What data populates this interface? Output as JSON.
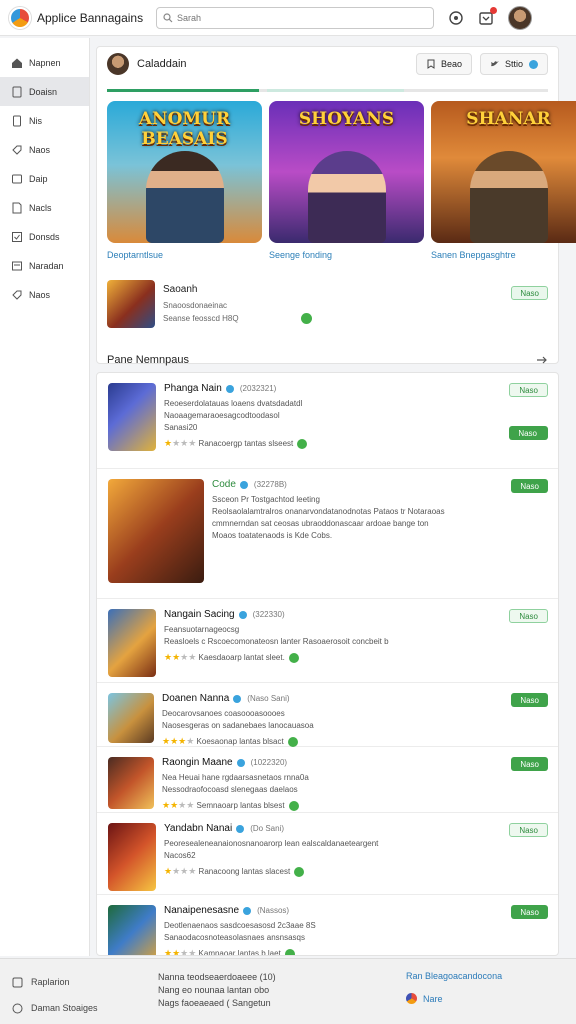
{
  "header": {
    "app_title": "Applice Bannagains",
    "search_placeholder": "Sarah"
  },
  "sidebar": {
    "items": [
      {
        "label": "Napnen",
        "icon": "home-icon"
      },
      {
        "label": "Doaisn",
        "icon": "document-icon"
      },
      {
        "label": "Nis",
        "icon": "page-icon"
      },
      {
        "label": "Naos",
        "icon": "tag-icon"
      },
      {
        "label": "Daip",
        "icon": "folder-icon"
      },
      {
        "label": "Nacls",
        "icon": "note-icon"
      },
      {
        "label": "Donsds",
        "icon": "check-icon"
      },
      {
        "label": "Naradan",
        "icon": "list-icon"
      },
      {
        "label": "Naos",
        "icon": "tag-icon"
      }
    ],
    "active_index": 1
  },
  "feature": {
    "title": "Caladdain",
    "btn1": "Beao",
    "btn2": "Sttio",
    "tiles": [
      {
        "logo": "ANOMUR BEASAIS",
        "caption": "Deoptarntlsue"
      },
      {
        "logo": "SHOYANS",
        "caption": "Seenge fonding"
      },
      {
        "logo": "SHANAR",
        "caption": "Sanen Bnepgasghtre"
      }
    ],
    "mini": {
      "title": "Saoanh",
      "line1": "Snaoosdonaeinac",
      "line2": "Seanse feosscd H8Q",
      "tag": "Naso"
    },
    "section_title": "Pane Nemnpaus"
  },
  "list": [
    {
      "title": "Phanga Nain",
      "count": "(2032321)",
      "lines": [
        "Reoeserdolatauas loaens dvatsdadatdl",
        "Naoaagemaraoesagcodtoodasol",
        "Sanasi20"
      ],
      "rating_text": "Ranacoergp tantas slseest",
      "stars": 1,
      "btn_top": "Naso",
      "btn_bottom": "Naso",
      "accent": "#3aa3dd"
    },
    {
      "title": "Code",
      "count": "(32278B)",
      "lines": [
        "Ssceon Pr Tostgachtod leeting",
        "Reolsaolalamtralros onanarvondatanodnotas Pataos tr Notaraoas",
        "cmmnerndan sat ceosas ubraoddonascaar ardoae bange ton",
        "Moaos toatatenaods is Kde Cobs."
      ],
      "rating_text": "",
      "stars": 0,
      "btn_top": "Naso",
      "btn_bottom": "",
      "accent": "#2e8b3e"
    },
    {
      "title": "Nangain Sacing",
      "count": "(322330)",
      "lines": [
        "Feansuotarnageocsg",
        "Reasloels c Rscoecomonateosn lanter Rasoaerosoit concbeit b"
      ],
      "rating_text": "Kaesdaoarp lantat sleet.",
      "stars": 2,
      "btn_top": "Naso",
      "btn_bottom": "",
      "accent": "#3aa3dd"
    },
    {
      "title": "Doanen Nanna",
      "count": "(Naso Sani)",
      "lines": [
        "Deocarovsanoes coasoooasoooes",
        "Naosesgeras on sadanebaes lanocauasoa"
      ],
      "rating_text": "Koesaonap lantas blsact",
      "stars": 3,
      "btn_top": "Naso",
      "btn_bottom": "",
      "accent": "#3aa3dd"
    },
    {
      "title": "Raongin Maane",
      "count": "(1022320)",
      "lines": [
        "Nea Heuai hane rgdaarsasnetaos rnna0a",
        "Nessodraofocoasd slenegaas daelaos"
      ],
      "rating_text": "Semnaoarp lantas blsest",
      "stars": 2,
      "btn_top": "Naso",
      "btn_bottom": "",
      "accent": "#3aa3dd"
    },
    {
      "title": "Yandabn Nanai",
      "count": "(Do Sani)",
      "lines": [
        "Peoresealeneanaionosnanoarorp lean ealscaldanaeteargent",
        "Nacos62"
      ],
      "rating_text": "Ranacoong lantas slacest",
      "stars": 1,
      "btn_top": "Naso",
      "btn_bottom": "",
      "accent": "#3aa3dd"
    },
    {
      "title": "Nanaipenesasne",
      "count": "(Nassos)",
      "lines": [
        "Deotlenaenaos sasdcoesasosd 2c3aae 8S",
        "Sanaodacosnoteasolasnaes ansnsasqs"
      ],
      "rating_text": "Kamnaoar lantas b laet",
      "stars": 2,
      "btn_top": "Naso",
      "btn_bottom": "",
      "accent": "#3aa3dd"
    }
  ],
  "footer": {
    "left": [
      "Raplarion",
      "Daman Stoaiges"
    ],
    "mid": [
      "Nanna teodseaerdoaeee (10)",
      "Nang eo nounaa lantan obo",
      "Nags faoeaeaed ( Sangetun"
    ],
    "right_link": "Ran Bleagoacandocona",
    "right_user": "Nare"
  }
}
